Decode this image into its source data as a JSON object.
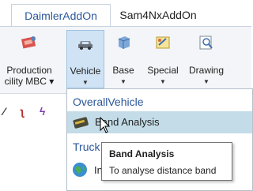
{
  "tabs": {
    "active": "DaimlerAddOn",
    "inactive": "Sam4NxAddOn"
  },
  "ribbon": {
    "production": {
      "line1": "Production",
      "line2": "cility MBC ▾",
      "icon": "production-facility-icon"
    },
    "vehicle": {
      "label": "Vehicle",
      "icon": "car-icon"
    },
    "base": {
      "label": "Base",
      "icon": "cube-icon"
    },
    "special": {
      "label": "Special",
      "icon": "special-icon"
    },
    "drawing": {
      "label": "Drawing",
      "icon": "drawing-icon"
    }
  },
  "menu": {
    "section1": "OverallVehicle",
    "item1": "Band Analysis",
    "section2": "Truck",
    "item2": "In"
  },
  "tooltip": {
    "title": "Band Analysis",
    "description": "To analyse distance band"
  },
  "colors": {
    "accent": "#2b579a",
    "highlight": "#c3dce8",
    "pressed": "#cfe3f5"
  }
}
